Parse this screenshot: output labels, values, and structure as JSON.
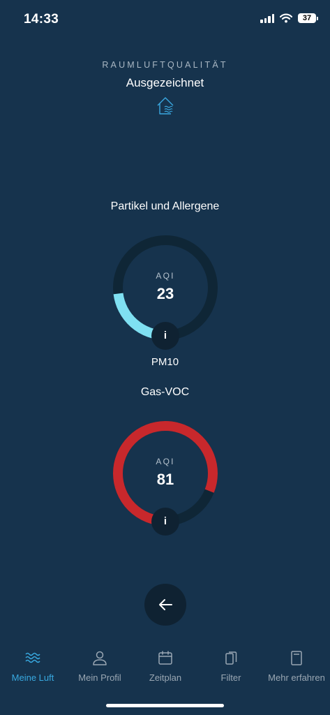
{
  "status_bar": {
    "time": "14:33",
    "battery": "37"
  },
  "header": {
    "section_label": "RAUMLUFTQUALITÄT",
    "status": "Ausgezeichnet"
  },
  "gauges": [
    {
      "title": "Partikel und Allergene",
      "aqi_label": "AQI",
      "value": "23",
      "fill_fraction": 0.23,
      "color": "#7fe0f2",
      "track_color": "#0f2636",
      "sub_label": "PM10",
      "info_label": "i"
    },
    {
      "title": "Gas-VOC",
      "aqi_label": "AQI",
      "value": "81",
      "fill_fraction": 0.81,
      "color": "#c8282c",
      "track_color": "#0f2636",
      "info_label": "i"
    }
  ],
  "tabs": [
    {
      "label": "Meine Luft",
      "icon": "waves-icon",
      "active": true
    },
    {
      "label": "Mein Profil",
      "icon": "person-icon",
      "active": false
    },
    {
      "label": "Zeitplan",
      "icon": "calendar-icon",
      "active": false
    },
    {
      "label": "Filter",
      "icon": "filter-icon",
      "active": false
    },
    {
      "label": "Mehr erfahren",
      "icon": "book-icon",
      "active": false
    }
  ],
  "colors": {
    "background": "#16334d",
    "accent": "#38a9e0",
    "button_bg": "#0f2232"
  }
}
